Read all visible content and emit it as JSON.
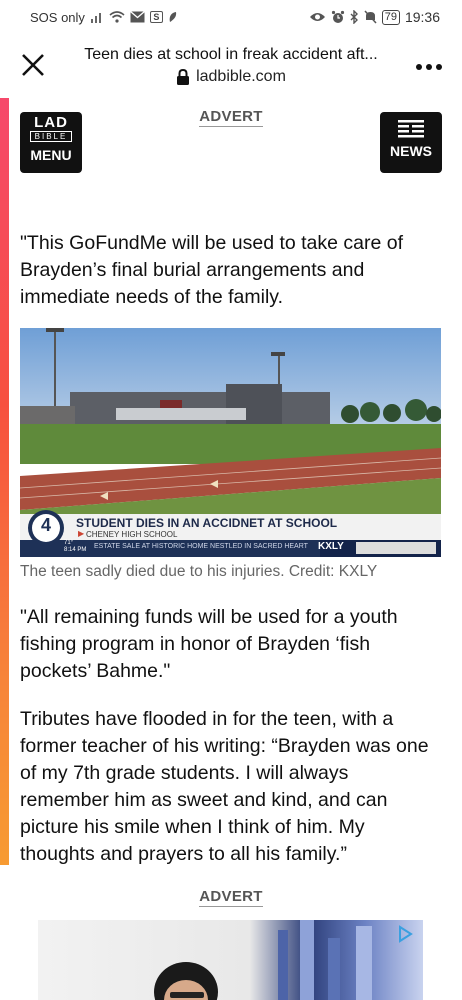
{
  "status_bar": {
    "carrier": "SOS only",
    "battery": "79",
    "time": "19:36"
  },
  "browser": {
    "page_title": "Teen dies at school in freak accident aft...",
    "domain": "ladbible.com"
  },
  "header": {
    "advert_label": "ADVERT",
    "logo": {
      "line1": "LAD",
      "line2": "BIBLE",
      "menu": "MENU"
    },
    "news_label": "NEWS"
  },
  "article": {
    "paragraph1": "\"This GoFundMe will be used to take care of Brayden’s final burial arrangements and immediate needs of the family.",
    "video": {
      "headline": "STUDENT DIES IN AN ACCIDNET AT SCHOOL",
      "subline": "CHENEY HIGH SCHOOL",
      "temp": "71°",
      "time": "8:14 PM",
      "ticker": "ESTATE SALE AT HISTORIC HOME NESTLED IN SACRED HEART",
      "channel": "KXLY",
      "channel_number": "4"
    },
    "caption": "The teen sadly died due to his injuries. Credit: KXLY",
    "paragraph2": "\"All remaining funds will be used for a youth fishing program in honor of Brayden ‘fish pockets’ Bahme.\"",
    "paragraph3": "Tributes have flooded in for the teen, with a former teacher of his writing: “Brayden was one of my 7th grade students. I will always remember him as sweet and kind, and can picture his smile when I think of him. My thoughts and prayers to all his family.”"
  },
  "footer": {
    "advert_label": "ADVERT"
  },
  "colors": {
    "accent_gradient_top": "#f6496b",
    "accent_gradient_bottom": "#f79b32",
    "logo_bg": "#111111"
  }
}
